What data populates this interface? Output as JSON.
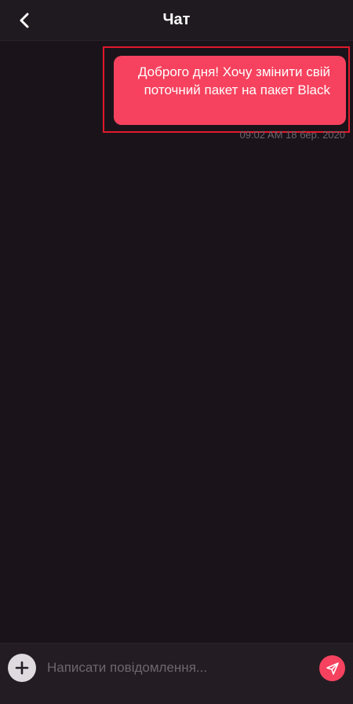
{
  "header": {
    "title": "Чат",
    "back_icon": "chevron-left-icon"
  },
  "messages": [
    {
      "direction": "outgoing",
      "text": "Доброго дня! Хочу змінити свій поточний пакет на пакет Black",
      "timestamp": "09:02 AM 18 бер. 2020",
      "highlighted": true
    }
  ],
  "composer": {
    "add_icon": "plus-icon",
    "placeholder": "Написати повідомлення...",
    "value": "",
    "send_icon": "send-icon"
  },
  "colors": {
    "background": "#1a141a",
    "header": "#1f1a1f",
    "accent": "#f6425e",
    "highlight_border": "#e0192d",
    "muted_text": "#6e656d"
  }
}
